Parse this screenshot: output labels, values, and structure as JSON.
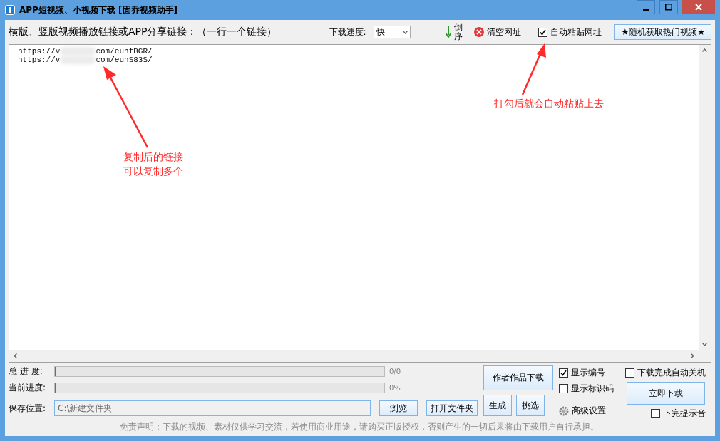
{
  "window": {
    "title": "APP短视频、小视频下载 [固乔视频助手]"
  },
  "toolbar": {
    "prompt": "横版、竖版视频播放链接或APP分享链接：（一行一个链接）",
    "speed_label": "下载速度:",
    "speed_value": "快",
    "reverse_button": "倒序",
    "clear_button": "清空网址",
    "auto_paste": {
      "label": "自动粘贴网址",
      "checked": true
    },
    "random_button": "★随机获取热门视频★"
  },
  "links": [
    {
      "start": "https://v",
      "end": "com/euhfBGR/"
    },
    {
      "start": "https://v",
      "end": "com/euhS83S/"
    }
  ],
  "annotations": [
    {
      "lines": [
        "复制后的链接",
        "可以复制多个"
      ]
    },
    {
      "lines": [
        "打勾后就会自动粘贴上去"
      ]
    }
  ],
  "progress": [
    {
      "label": "总 进 度:",
      "level": 0,
      "reading": "0/0"
    },
    {
      "label": "当前进度:",
      "level": 0,
      "reading": "0%"
    }
  ],
  "save": {
    "label": "保存位置:",
    "value": "C:\\新建文件夹",
    "browse_button": "浏览",
    "open_button": "打开文件夹"
  },
  "author_button": "作者作品下载",
  "generate_button": "生成",
  "pick_button": "挑选",
  "options": [
    {
      "label": "显示编号",
      "checked": true
    },
    {
      "label": "显示标识码",
      "checked": false
    }
  ],
  "settings_button": "高级设置",
  "shutdown": {
    "label": "下载完成自动关机",
    "checked": false
  },
  "download_button": "立即下载",
  "sound": {
    "label": "下完提示音",
    "checked": false
  },
  "disclaimer": "免责声明：下载的视频、素材仅供学习交流，若使用商业用途，请购买正版授权，否则产生的一切后果将由下载用户自行承担。"
}
